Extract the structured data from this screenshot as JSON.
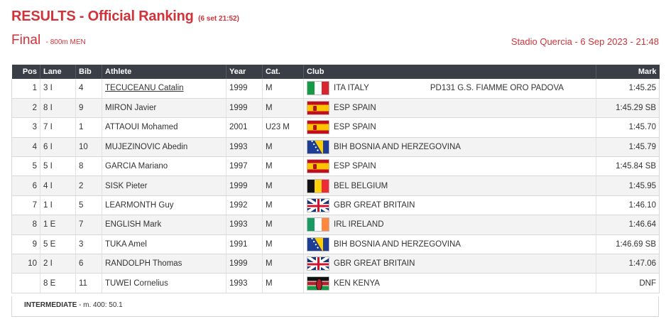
{
  "header": {
    "title": "RESULTS - Official Ranking",
    "timestamp": "(6 set 21:52)",
    "round": "Final",
    "event": "- 800m MEN",
    "venue": "Stadio Quercia - 6 Sep 2023 - 21:48"
  },
  "table": {
    "columns": {
      "pos": "Pos",
      "lane": "Lane",
      "bib": "Bib",
      "athlete": "Athlete",
      "year": "Year",
      "cat": "Cat.",
      "club": "Club",
      "mark": "Mark"
    },
    "rows": [
      {
        "pos": "1",
        "lane": "3 I",
        "bib": "4",
        "athlete": "TECUCEANU Catalin",
        "year": "1999",
        "cat": "M",
        "flag": "flag-italy-icon",
        "nation": "ITA ITALY",
        "club": "PD131 G.S. FIAMME ORO PADOVA",
        "mark": "1:45.25"
      },
      {
        "pos": "2",
        "lane": "8 I",
        "bib": "9",
        "athlete": "MIRON Javier",
        "year": "1999",
        "cat": "M",
        "flag": "flag-spain-icon",
        "nation": "ESP SPAIN",
        "club": "",
        "mark": "1:45.29 SB"
      },
      {
        "pos": "3",
        "lane": "7 I",
        "bib": "1",
        "athlete": "ATTAOUI Mohamed",
        "year": "2001",
        "cat": "U23 M",
        "flag": "flag-spain-icon",
        "nation": "ESP SPAIN",
        "club": "",
        "mark": "1:45.70"
      },
      {
        "pos": "4",
        "lane": "6 I",
        "bib": "10",
        "athlete": "MUJEZINOVIC Abedin",
        "year": "1993",
        "cat": "M",
        "flag": "flag-bosnia-icon",
        "nation": "BIH BOSNIA AND HERZEGOVINA",
        "club": "",
        "mark": "1:45.79"
      },
      {
        "pos": "5",
        "lane": "5 I",
        "bib": "8",
        "athlete": "GARCIA Mariano",
        "year": "1997",
        "cat": "M",
        "flag": "flag-spain-icon",
        "nation": "ESP SPAIN",
        "club": "",
        "mark": "1:45.84 SB"
      },
      {
        "pos": "6",
        "lane": "4 I",
        "bib": "2",
        "athlete": "SISK Pieter",
        "year": "1999",
        "cat": "M",
        "flag": "flag-belgium-icon",
        "nation": "BEL BELGIUM",
        "club": "",
        "mark": "1:45.95"
      },
      {
        "pos": "7",
        "lane": "1 I",
        "bib": "5",
        "athlete": "LEARMONTH Guy",
        "year": "1992",
        "cat": "M",
        "flag": "flag-great-britain-icon",
        "nation": "GBR GREAT BRITAIN",
        "club": "",
        "mark": "1:46.10"
      },
      {
        "pos": "8",
        "lane": "1 E",
        "bib": "7",
        "athlete": "ENGLISH Mark",
        "year": "1993",
        "cat": "M",
        "flag": "flag-ireland-icon",
        "nation": "IRL IRELAND",
        "club": "",
        "mark": "1:46.64"
      },
      {
        "pos": "9",
        "lane": "5 E",
        "bib": "3",
        "athlete": "TUKA Amel",
        "year": "1991",
        "cat": "M",
        "flag": "flag-bosnia-icon",
        "nation": "BIH BOSNIA AND HERZEGOVINA",
        "club": "",
        "mark": "1:46.69 SB"
      },
      {
        "pos": "10",
        "lane": "2 I",
        "bib": "6",
        "athlete": "RANDOLPH Thomas",
        "year": "1999",
        "cat": "M",
        "flag": "flag-great-britain-icon",
        "nation": "GBR GREAT BRITAIN",
        "club": "",
        "mark": "1:47.06"
      },
      {
        "pos": "",
        "lane": "8 E",
        "bib": "11",
        "athlete": "TUWEI Cornelius",
        "year": "1993",
        "cat": "M",
        "flag": "flag-kenya-icon",
        "nation": "KEN KENYA",
        "club": "",
        "mark": "DNF"
      }
    ]
  },
  "intermediate": {
    "label": "INTERMEDIATE",
    "text": " - m. 400: 50.1"
  }
}
